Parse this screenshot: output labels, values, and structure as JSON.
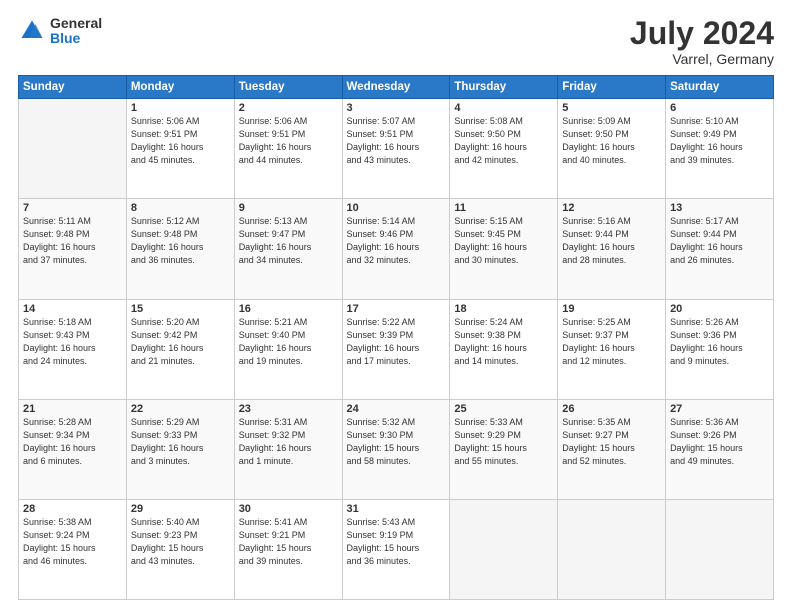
{
  "header": {
    "logo_general": "General",
    "logo_blue": "Blue",
    "month_title": "July 2024",
    "location": "Varrel, Germany"
  },
  "days_of_week": [
    "Sunday",
    "Monday",
    "Tuesday",
    "Wednesday",
    "Thursday",
    "Friday",
    "Saturday"
  ],
  "weeks": [
    [
      {
        "day": "",
        "info": ""
      },
      {
        "day": "1",
        "info": "Sunrise: 5:06 AM\nSunset: 9:51 PM\nDaylight: 16 hours\nand 45 minutes."
      },
      {
        "day": "2",
        "info": "Sunrise: 5:06 AM\nSunset: 9:51 PM\nDaylight: 16 hours\nand 44 minutes."
      },
      {
        "day": "3",
        "info": "Sunrise: 5:07 AM\nSunset: 9:51 PM\nDaylight: 16 hours\nand 43 minutes."
      },
      {
        "day": "4",
        "info": "Sunrise: 5:08 AM\nSunset: 9:50 PM\nDaylight: 16 hours\nand 42 minutes."
      },
      {
        "day": "5",
        "info": "Sunrise: 5:09 AM\nSunset: 9:50 PM\nDaylight: 16 hours\nand 40 minutes."
      },
      {
        "day": "6",
        "info": "Sunrise: 5:10 AM\nSunset: 9:49 PM\nDaylight: 16 hours\nand 39 minutes."
      }
    ],
    [
      {
        "day": "7",
        "info": "Sunrise: 5:11 AM\nSunset: 9:48 PM\nDaylight: 16 hours\nand 37 minutes."
      },
      {
        "day": "8",
        "info": "Sunrise: 5:12 AM\nSunset: 9:48 PM\nDaylight: 16 hours\nand 36 minutes."
      },
      {
        "day": "9",
        "info": "Sunrise: 5:13 AM\nSunset: 9:47 PM\nDaylight: 16 hours\nand 34 minutes."
      },
      {
        "day": "10",
        "info": "Sunrise: 5:14 AM\nSunset: 9:46 PM\nDaylight: 16 hours\nand 32 minutes."
      },
      {
        "day": "11",
        "info": "Sunrise: 5:15 AM\nSunset: 9:45 PM\nDaylight: 16 hours\nand 30 minutes."
      },
      {
        "day": "12",
        "info": "Sunrise: 5:16 AM\nSunset: 9:44 PM\nDaylight: 16 hours\nand 28 minutes."
      },
      {
        "day": "13",
        "info": "Sunrise: 5:17 AM\nSunset: 9:44 PM\nDaylight: 16 hours\nand 26 minutes."
      }
    ],
    [
      {
        "day": "14",
        "info": "Sunrise: 5:18 AM\nSunset: 9:43 PM\nDaylight: 16 hours\nand 24 minutes."
      },
      {
        "day": "15",
        "info": "Sunrise: 5:20 AM\nSunset: 9:42 PM\nDaylight: 16 hours\nand 21 minutes."
      },
      {
        "day": "16",
        "info": "Sunrise: 5:21 AM\nSunset: 9:40 PM\nDaylight: 16 hours\nand 19 minutes."
      },
      {
        "day": "17",
        "info": "Sunrise: 5:22 AM\nSunset: 9:39 PM\nDaylight: 16 hours\nand 17 minutes."
      },
      {
        "day": "18",
        "info": "Sunrise: 5:24 AM\nSunset: 9:38 PM\nDaylight: 16 hours\nand 14 minutes."
      },
      {
        "day": "19",
        "info": "Sunrise: 5:25 AM\nSunset: 9:37 PM\nDaylight: 16 hours\nand 12 minutes."
      },
      {
        "day": "20",
        "info": "Sunrise: 5:26 AM\nSunset: 9:36 PM\nDaylight: 16 hours\nand 9 minutes."
      }
    ],
    [
      {
        "day": "21",
        "info": "Sunrise: 5:28 AM\nSunset: 9:34 PM\nDaylight: 16 hours\nand 6 minutes."
      },
      {
        "day": "22",
        "info": "Sunrise: 5:29 AM\nSunset: 9:33 PM\nDaylight: 16 hours\nand 3 minutes."
      },
      {
        "day": "23",
        "info": "Sunrise: 5:31 AM\nSunset: 9:32 PM\nDaylight: 16 hours\nand 1 minute."
      },
      {
        "day": "24",
        "info": "Sunrise: 5:32 AM\nSunset: 9:30 PM\nDaylight: 15 hours\nand 58 minutes."
      },
      {
        "day": "25",
        "info": "Sunrise: 5:33 AM\nSunset: 9:29 PM\nDaylight: 15 hours\nand 55 minutes."
      },
      {
        "day": "26",
        "info": "Sunrise: 5:35 AM\nSunset: 9:27 PM\nDaylight: 15 hours\nand 52 minutes."
      },
      {
        "day": "27",
        "info": "Sunrise: 5:36 AM\nSunset: 9:26 PM\nDaylight: 15 hours\nand 49 minutes."
      }
    ],
    [
      {
        "day": "28",
        "info": "Sunrise: 5:38 AM\nSunset: 9:24 PM\nDaylight: 15 hours\nand 46 minutes."
      },
      {
        "day": "29",
        "info": "Sunrise: 5:40 AM\nSunset: 9:23 PM\nDaylight: 15 hours\nand 43 minutes."
      },
      {
        "day": "30",
        "info": "Sunrise: 5:41 AM\nSunset: 9:21 PM\nDaylight: 15 hours\nand 39 minutes."
      },
      {
        "day": "31",
        "info": "Sunrise: 5:43 AM\nSunset: 9:19 PM\nDaylight: 15 hours\nand 36 minutes."
      },
      {
        "day": "",
        "info": ""
      },
      {
        "day": "",
        "info": ""
      },
      {
        "day": "",
        "info": ""
      }
    ]
  ]
}
